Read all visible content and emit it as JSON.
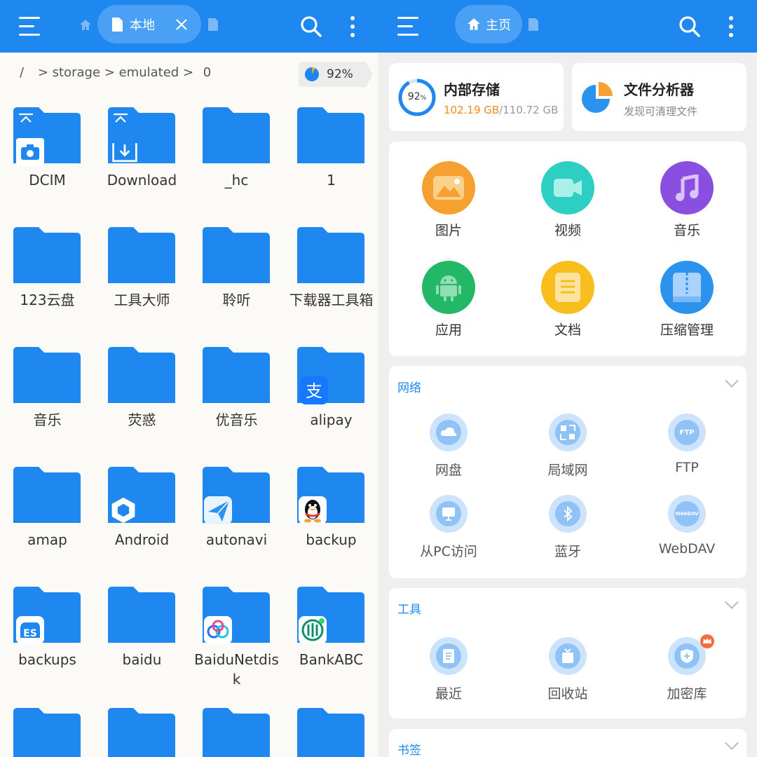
{
  "left_header": {
    "tab_label": "本地"
  },
  "right_header": {
    "tab_label": "主页"
  },
  "breadcrumb": {
    "root": "/",
    "sep1": ">",
    "seg1": "storage",
    "sep2": ">",
    "seg2": "emulated",
    "sep3": ">",
    "seg3": "0"
  },
  "usage": {
    "percent_label": "92%",
    "percent": 92
  },
  "folders": [
    {
      "name": "DCIM",
      "badge": "camera-icon"
    },
    {
      "name": "Download",
      "badge": "download-icon"
    },
    {
      "name": "_hc",
      "badge": ""
    },
    {
      "name": "1",
      "badge": ""
    },
    {
      "name": "123云盘",
      "badge": ""
    },
    {
      "name": "工具大师",
      "badge": ""
    },
    {
      "name": "聆听",
      "badge": ""
    },
    {
      "name": "下载器工具箱",
      "badge": ""
    },
    {
      "name": "音乐",
      "badge": ""
    },
    {
      "name": "荧惑",
      "badge": ""
    },
    {
      "name": "优音乐",
      "badge": ""
    },
    {
      "name": "alipay",
      "badge": "alipay-icon"
    },
    {
      "name": "amap",
      "badge": ""
    },
    {
      "name": "Android",
      "badge": "android-hex-icon"
    },
    {
      "name": "autonavi",
      "badge": "autonavi-icon"
    },
    {
      "name": "backup",
      "badge": "qq-penguin-icon"
    },
    {
      "name": "backups",
      "badge": "es-icon"
    },
    {
      "name": "baidu",
      "badge": ""
    },
    {
      "name": "BaiduNetdisk",
      "badge": "baidu-netdisk-icon"
    },
    {
      "name": "BankABC",
      "badge": "bankabc-icon"
    }
  ],
  "storage_card": {
    "title": "内部存储",
    "used": "102.19 GB",
    "total": "/110.72 GB",
    "ring_label": "92",
    "ring_unit": "%",
    "percent": 92
  },
  "analyzer_card": {
    "title": "文件分析器",
    "subtitle": "发现可清理文件"
  },
  "categories": [
    {
      "label": "图片",
      "icon": "image-icon",
      "color": "#f5a030"
    },
    {
      "label": "视频",
      "icon": "video-icon",
      "color": "#2dcfc3"
    },
    {
      "label": "音乐",
      "icon": "music-icon",
      "color": "#8a4fe0"
    },
    {
      "label": "应用",
      "icon": "android-icon",
      "color": "#22b866"
    },
    {
      "label": "文档",
      "icon": "document-icon",
      "color": "#f7be1e"
    },
    {
      "label": "压缩管理",
      "icon": "zip-icon",
      "color": "#2b93ee"
    }
  ],
  "network": {
    "title": "网络",
    "items": [
      {
        "label": "网盘",
        "icon": "cloud-drive-icon",
        "glyph": ""
      },
      {
        "label": "局域网",
        "icon": "lan-icon",
        "glyph": ""
      },
      {
        "label": "FTP",
        "icon": "ftp-icon",
        "glyph": "FTP"
      },
      {
        "label": "从PC访问",
        "icon": "pc-icon",
        "glyph": ""
      },
      {
        "label": "蓝牙",
        "icon": "bluetooth-icon",
        "glyph": ""
      },
      {
        "label": "WebDAV",
        "icon": "webdav-icon",
        "glyph": "WebDAV"
      }
    ]
  },
  "tools": {
    "title": "工具",
    "items": [
      {
        "label": "最近",
        "icon": "recent-icon"
      },
      {
        "label": "回收站",
        "icon": "recycle-bin-icon"
      },
      {
        "label": "加密库",
        "icon": "vault-shield-icon"
      }
    ]
  },
  "bookmarks": {
    "title": "书签"
  },
  "colors": {
    "primary": "#1e88f0",
    "folder": "#1e88f0",
    "used_orange": "#f08a1c"
  }
}
